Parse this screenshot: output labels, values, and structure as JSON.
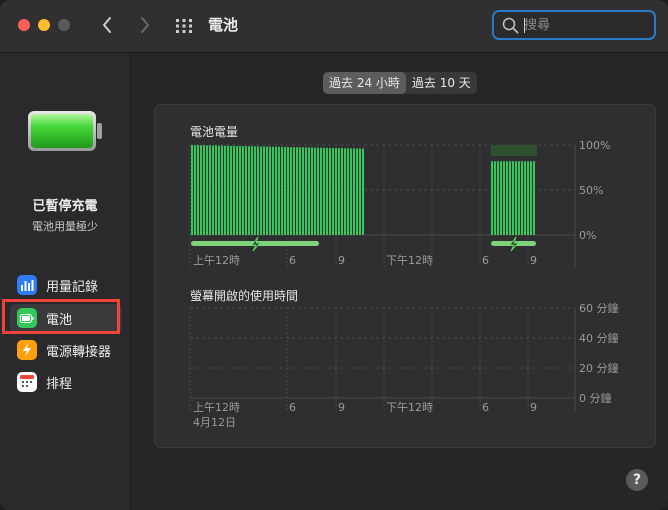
{
  "window": {
    "title": "電池",
    "search_placeholder": "搜尋"
  },
  "sidebar": {
    "status_title": "已暫停充電",
    "status_subtitle": "電池用量極少",
    "items": [
      {
        "label": "用量記錄",
        "icon": "bar-chart-icon",
        "color": "#2f7cf6"
      },
      {
        "label": "電池",
        "icon": "battery-icon",
        "color": "#34c759"
      },
      {
        "label": "電源轉接器",
        "icon": "lightning-icon",
        "color": "#ff9f0a"
      },
      {
        "label": "排程",
        "icon": "calendar-icon",
        "color": "#ffffff"
      }
    ]
  },
  "segmented": {
    "options": [
      "過去 24 小時",
      "過去 10 天"
    ],
    "selected": 0
  },
  "battery_chart": {
    "title": "電池電量",
    "y_ticks": [
      "100%",
      "50%",
      "0%"
    ],
    "x_ticks": [
      "上午12時",
      "6",
      "9",
      "下午12時",
      "6",
      "9"
    ]
  },
  "screen_chart": {
    "title": "螢幕開啟的使用時間",
    "y_ticks": [
      "60 分鐘",
      "40 分鐘",
      "20 分鐘",
      "0 分鐘"
    ],
    "x_ticks": [
      "上午12時",
      "6",
      "9",
      "下午12時",
      "6",
      "9"
    ],
    "date_label": "4月12日"
  },
  "chart_data": [
    {
      "type": "bar",
      "title": "電池電量",
      "ylabel": "",
      "ylim": [
        0,
        100
      ],
      "segments": [
        {
          "level_start": 100,
          "level_end": 96
        },
        {
          "level_start": 82,
          "level_end": 82
        }
      ],
      "charging_periods": 2
    },
    {
      "type": "bar",
      "title": "螢幕開啟的使用時間",
      "ylim": [
        0,
        60
      ],
      "values": []
    }
  ],
  "help_label": "?",
  "colors": {
    "accent": "#2a7ac8",
    "battery_green": "#34c759",
    "highlight": "#f0433a"
  }
}
